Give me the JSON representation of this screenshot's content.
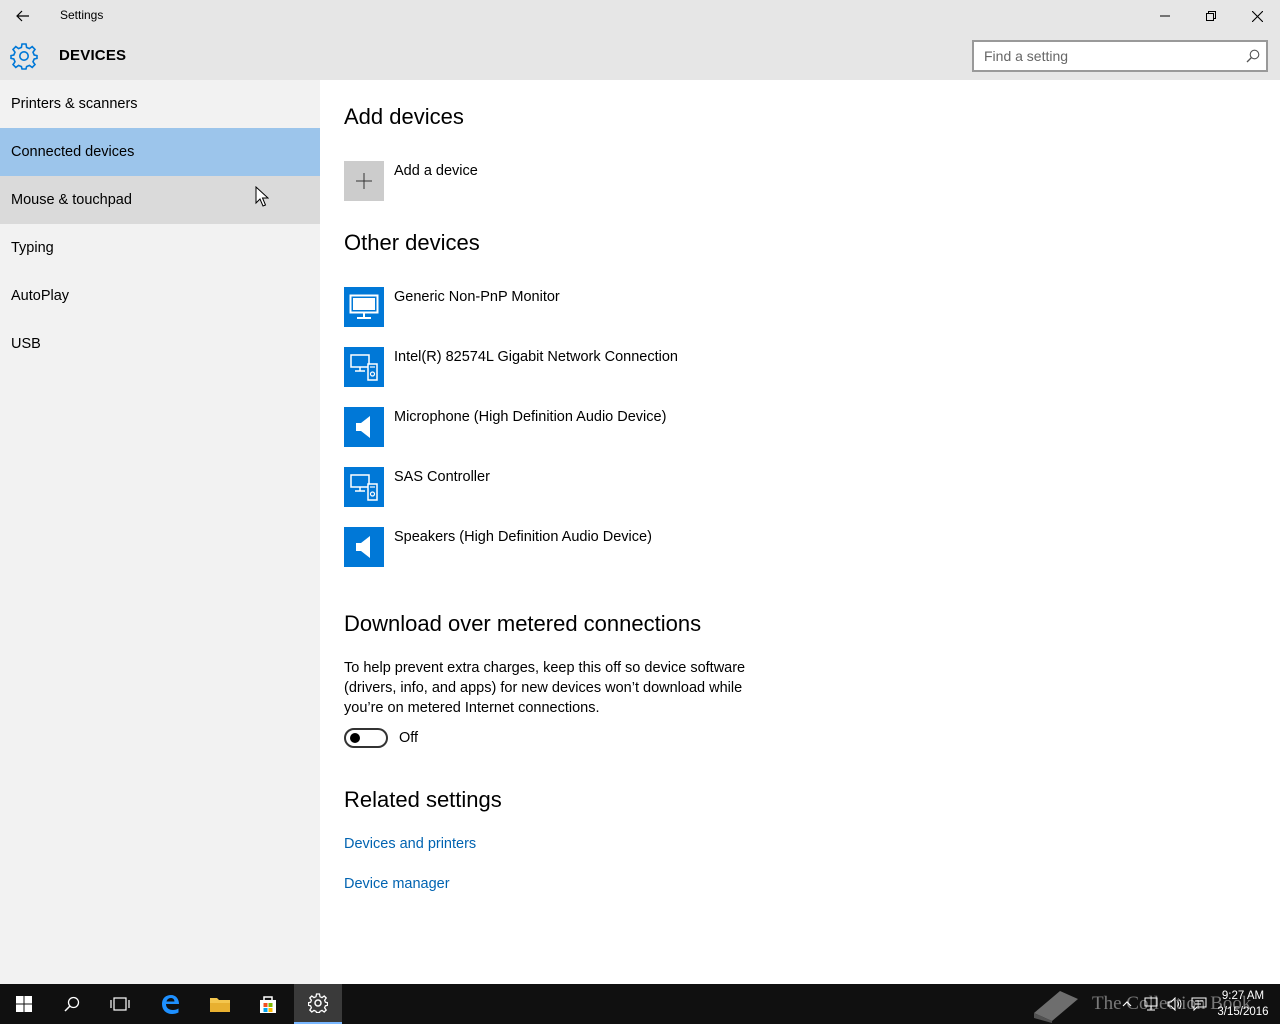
{
  "window": {
    "title": "Settings",
    "back_icon": "back-arrow-icon",
    "minimize_icon": "minimize-icon",
    "maximize_icon": "restore-icon",
    "close_icon": "close-icon"
  },
  "header": {
    "icon": "gear-icon",
    "title": "DEVICES",
    "search_placeholder": "Find a setting"
  },
  "sidebar": {
    "items": [
      {
        "label": "Printers & scanners",
        "state": "normal"
      },
      {
        "label": "Connected devices",
        "state": "selected"
      },
      {
        "label": "Mouse & touchpad",
        "state": "hover"
      },
      {
        "label": "Typing",
        "state": "normal"
      },
      {
        "label": "AutoPlay",
        "state": "normal"
      },
      {
        "label": "USB",
        "state": "normal"
      }
    ]
  },
  "main": {
    "add_devices": {
      "heading": "Add devices",
      "add_label": "Add a device"
    },
    "other_devices": {
      "heading": "Other devices",
      "devices": [
        {
          "name": "Generic Non-PnP Monitor",
          "icon": "monitor-icon"
        },
        {
          "name": "Intel(R) 82574L Gigabit Network Connection",
          "icon": "device-generic-icon"
        },
        {
          "name": "Microphone (High Definition Audio Device)",
          "icon": "speaker-icon"
        },
        {
          "name": "SAS Controller",
          "icon": "device-generic-icon"
        },
        {
          "name": "Speakers (High Definition Audio Device)",
          "icon": "speaker-icon"
        }
      ]
    },
    "metered": {
      "heading": "Download over metered connections",
      "description": "To help prevent extra charges, keep this off so device software (drivers, info, and apps) for new devices won’t download while you’re on metered Internet connections.",
      "toggle_state": "Off"
    },
    "related": {
      "heading": "Related settings",
      "links": [
        "Devices and printers",
        "Device manager"
      ]
    }
  },
  "taskbar": {
    "time": "9:27 AM",
    "date": "3/15/2016",
    "watermark": "The Collection Book",
    "accent_color": "#0078d7"
  }
}
